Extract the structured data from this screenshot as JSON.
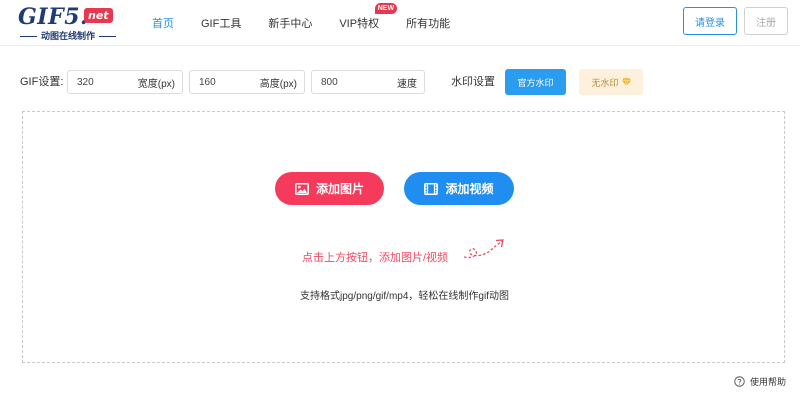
{
  "logo": {
    "main": "GIF5.",
    "net": "net",
    "subtitle": "动图在线制作"
  },
  "nav": {
    "items": [
      {
        "label": "首页"
      },
      {
        "label": "GIF工具"
      },
      {
        "label": "新手中心"
      },
      {
        "label": "VIP特权",
        "badge": "NEW"
      },
      {
        "label": "所有功能"
      }
    ]
  },
  "auth": {
    "login_label": "请登录",
    "register_label": "注册"
  },
  "settings": {
    "label": "GIF设置:",
    "width": {
      "value": "320",
      "unit": "宽度(px)"
    },
    "height": {
      "value": "160",
      "unit": "高度(px)"
    },
    "speed": {
      "value": "800",
      "unit": "速度"
    },
    "watermark_label": "水印设置",
    "watermark_official": "官方水印",
    "watermark_none": "无水印"
  },
  "upload": {
    "add_image": "添加图片",
    "add_video": "添加视频",
    "hint": "点击上方按钮，添加图片/视频",
    "formats": "支持格式jpg/png/gif/mp4，轻松在线制作gif动图"
  },
  "help": {
    "label": "使用帮助"
  },
  "colors": {
    "accent": "#2b8fe6",
    "image_button": "#f53a5b",
    "video_button": "#1f8ef0",
    "hint_text": "#f04a62",
    "watermark_none_bg": "#fdf0dc"
  }
}
